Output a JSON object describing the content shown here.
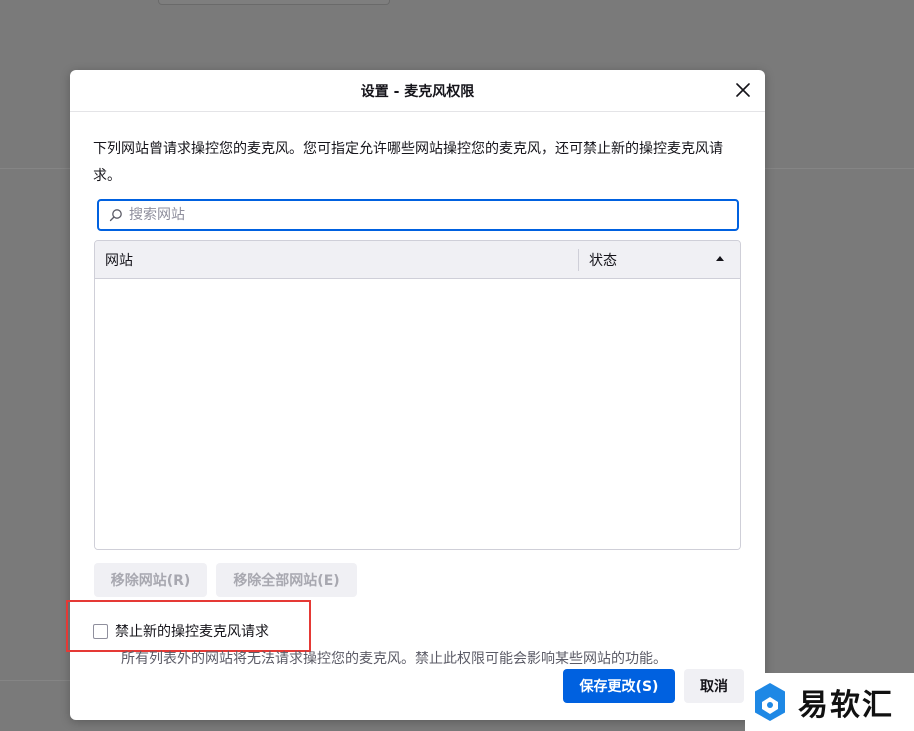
{
  "dialog": {
    "title": "设置 - 麦克风权限",
    "description": "下列网站曾请求操控您的麦克风。您可指定允许哪些网站操控您的麦克风，还可禁止新的操控麦克风请求。",
    "search_placeholder": "搜索网站",
    "table": {
      "columns": [
        "网站",
        "状态"
      ],
      "rows": []
    },
    "remove_site_label": "移除网站(R)",
    "remove_all_label": "移除全部网站(E)",
    "block_checkbox_label": "禁止新的操控麦克风请求",
    "block_checkbox_checked": false,
    "warning": "所有列表外的网站将无法请求操控您的麦克风。禁止此权限可能会影响某些网站的功能。",
    "save_label": "保存更改(S)",
    "cancel_label": "取消"
  },
  "watermark": {
    "text": "易软汇"
  },
  "colors": {
    "accent": "#0061e0",
    "highlight": "#e53935",
    "watermark_logo": "#1e88e5"
  }
}
